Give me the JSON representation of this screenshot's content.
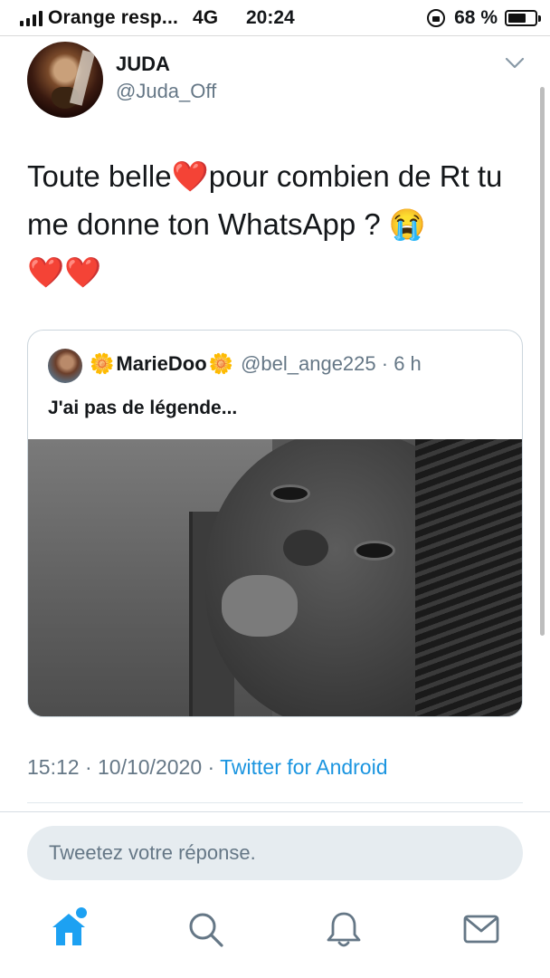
{
  "status_bar": {
    "carrier": "Orange resp...",
    "network": "4G",
    "time": "20:24",
    "battery": "68 %",
    "battery_level": 0.68
  },
  "tweet": {
    "author_name": "JUDA",
    "author_handle": "@Juda_Off",
    "text_part1": "Toute belle",
    "heart": "❤️",
    "text_part2": "pour combien de Rt tu me donne ton WhatsApp ? ",
    "emoji_cry": "😭",
    "hearts_line": "❤️❤️",
    "timestamp": "15:12 · 10/10/2020 · ",
    "source": "Twitter for Android"
  },
  "quoted_tweet": {
    "flower": "🌼",
    "name": "MarieDoo",
    "handle_time": "@bel_ange225 · 6 h",
    "text": "J'ai pas de légende..."
  },
  "reply": {
    "placeholder": "Tweetez votre réponse."
  },
  "tabs": {
    "home": "home-icon",
    "search": "search-icon",
    "notifications": "bell-icon",
    "messages": "mail-icon"
  },
  "colors": {
    "accent": "#1da1f2",
    "secondary_text": "#657786",
    "link": "#1b95e0"
  }
}
